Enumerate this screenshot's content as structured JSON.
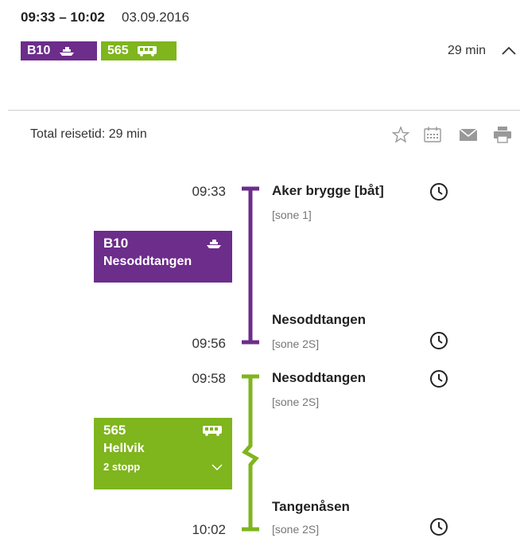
{
  "header": {
    "time_range": "09:33 – 10:02",
    "date": "03.09.2016",
    "duration": "29 min",
    "badges": [
      {
        "line": "B10",
        "mode_icon": "ferry-icon",
        "color": "#6c2d8b"
      },
      {
        "line": "565",
        "mode_icon": "bus-icon",
        "color": "#7fb51d"
      }
    ]
  },
  "summary": {
    "total_label": "Total reisetid: 29 min",
    "tools": [
      "star-icon",
      "calendar-icon",
      "mail-icon",
      "print-icon"
    ]
  },
  "legs": [
    {
      "line": "B10",
      "mode_icon": "ferry-icon",
      "destination": "Nesoddtangen",
      "color": "#6c2d8b",
      "from": {
        "time": "09:33",
        "stop": "Aker brygge [båt]",
        "zone": "[sone 1]"
      },
      "to": {
        "time": "09:56",
        "stop": "Nesoddtangen",
        "zone": "[sone 2S]"
      }
    },
    {
      "line": "565",
      "mode_icon": "bus-icon",
      "destination": "Hellvik",
      "stops_label": "2 stopp",
      "color": "#7fb51d",
      "from": {
        "time": "09:58",
        "stop": "Nesoddtangen",
        "zone": "[sone 2S]"
      },
      "to": {
        "time": "10:02",
        "stop": "Tangenåsen",
        "zone": "[sone 2S]"
      }
    }
  ]
}
